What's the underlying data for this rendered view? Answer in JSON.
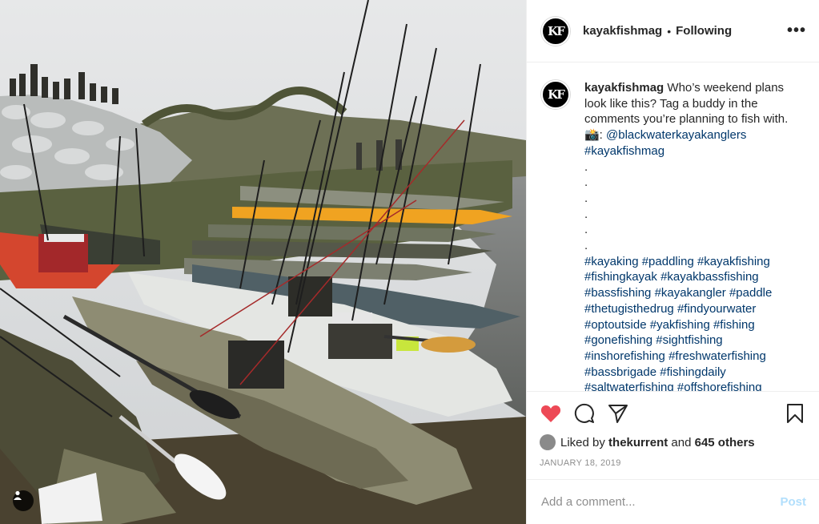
{
  "post": {
    "username": "kayakfishmag",
    "avatar_initials": "KF",
    "dot": "•",
    "follow_status": "Following",
    "more_glyph": "•••",
    "caption": {
      "username": "kayakfishmag",
      "text": "Who’s weekend plans look like this? Tag a buddy in the comments you’re planning to fish with.",
      "camera_emoji": "📸:",
      "mention": "@blackwaterkayakanglers",
      "hashtag_primary": "#kayakfishmag",
      "dots": [
        ".",
        ".",
        ".",
        ".",
        ".",
        "."
      ],
      "hashtags": [
        "#kayaking",
        "#paddling",
        "#kayakfishing",
        "#fishingkayak",
        "#kayakbassfishing",
        "#bassfishing",
        "#kayakangler",
        "#paddle",
        "#thetugisthedrug",
        "#findyourwater",
        "#optoutside",
        "#yakfishing",
        "#fishing",
        "#gonefishing",
        "#sightfishing",
        "#inshorefishing",
        "#freshwaterfishing",
        "#bassbrigade",
        "#fishingdaily",
        "#saltwaterfishing",
        "#offshorefishing"
      ]
    },
    "likes": {
      "prefix": "Liked by",
      "user": "thekurrent",
      "middle": "and",
      "others": "645 others"
    },
    "date": "JANUARY 18, 2019",
    "comment_placeholder": "Add a comment...",
    "post_button": "Post",
    "icons": {
      "like": "heart-filled-icon",
      "comment": "comment-icon",
      "share": "paper-plane-icon",
      "save": "bookmark-icon",
      "tag": "user-tag-icon"
    },
    "colors": {
      "like": "#ed4956",
      "link": "#00376b",
      "post_button": "#b2dffc"
    }
  }
}
